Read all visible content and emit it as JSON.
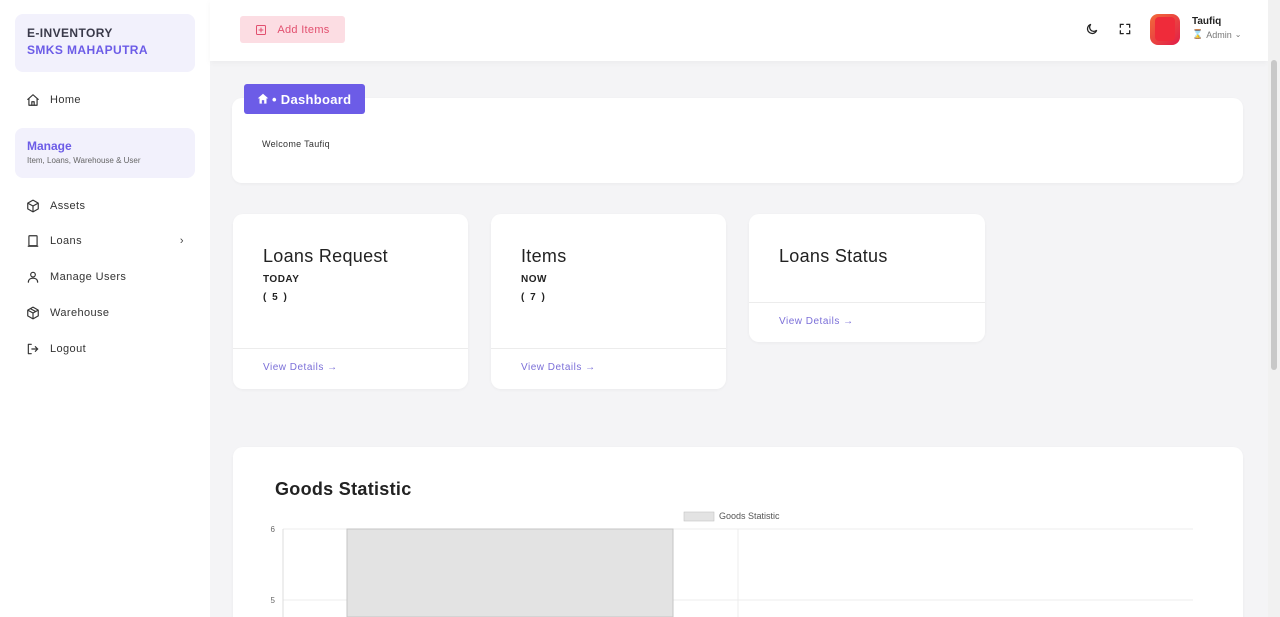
{
  "brand": {
    "line1": "E-INVENTORY",
    "line2": "SMKS MAHAPUTRA"
  },
  "sidebar": {
    "home": "Home",
    "manage_title": "Manage",
    "manage_subtitle": "Item, Loans, Warehouse & User",
    "items": [
      {
        "label": "Assets",
        "icon": "cube-icon"
      },
      {
        "label": "Loans",
        "icon": "tablet-icon"
      },
      {
        "label": "Manage Users",
        "icon": "user-icon"
      },
      {
        "label": "Warehouse",
        "icon": "box-icon"
      },
      {
        "label": "Logout",
        "icon": "logout-icon"
      }
    ]
  },
  "header": {
    "add_button": "Add Items",
    "user_name": "Taufiq",
    "user_role": "Admin"
  },
  "breadcrumb": {
    "label": "• Dashboard"
  },
  "welcome": "Welcome Taufiq",
  "cards": [
    {
      "title": "Loans Request",
      "subtitle": "TODAY",
      "count": "( 5 )",
      "link": "View Details →"
    },
    {
      "title": "Items",
      "subtitle": "NOW",
      "count": "( 7 )",
      "link": "View Details →"
    },
    {
      "title": "Loans Status",
      "link": "View Details →"
    }
  ],
  "goods": {
    "title": "Goods Statistic"
  },
  "chart_data": {
    "type": "bar",
    "legend": "Goods Statistic",
    "legend_position": "top",
    "y_ticks": [
      "6",
      "5"
    ],
    "series": [
      {
        "name": "Goods Statistic",
        "values": [
          6
        ]
      }
    ],
    "colors": {
      "bar": "#e3e3e3",
      "bar_border": "#c4c4c4"
    }
  },
  "colors": {
    "accent": "#6c5ce7",
    "add_button_bg": "#fcdde3",
    "add_button_text": "#e2506f"
  }
}
